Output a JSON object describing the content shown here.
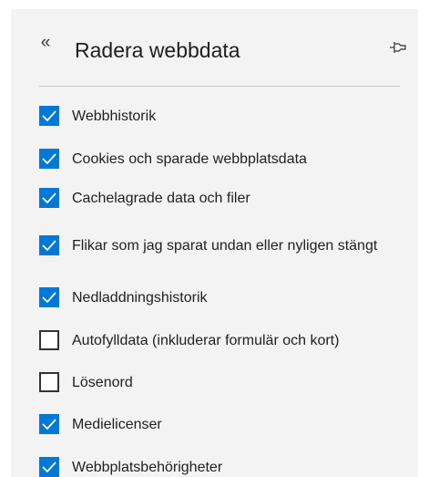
{
  "header": {
    "back_glyph": "«",
    "title": "Radera webbdata",
    "pin_icon": "pin-icon"
  },
  "colors": {
    "panel_background": "#f3f3f3",
    "checkbox_checked": "#0078d7",
    "checkbox_border": "#333333"
  },
  "options": [
    {
      "label": "Webbhistorik",
      "checked": true
    },
    {
      "label": "Cookies och sparade webbplatsdata",
      "checked": true
    },
    {
      "label": "Cachelagrade data och filer",
      "checked": true
    },
    {
      "label": "Flikar som jag sparat undan eller nyligen stängt",
      "checked": true
    },
    {
      "label": "Nedladdningshistorik",
      "checked": true
    },
    {
      "label": "Autofylldata (inkluderar formulär och kort)",
      "checked": false
    },
    {
      "label": "Lösenord",
      "checked": false
    },
    {
      "label": "Medielicenser",
      "checked": true
    },
    {
      "label": "Webbplatsbehörigheter",
      "checked": true
    }
  ]
}
